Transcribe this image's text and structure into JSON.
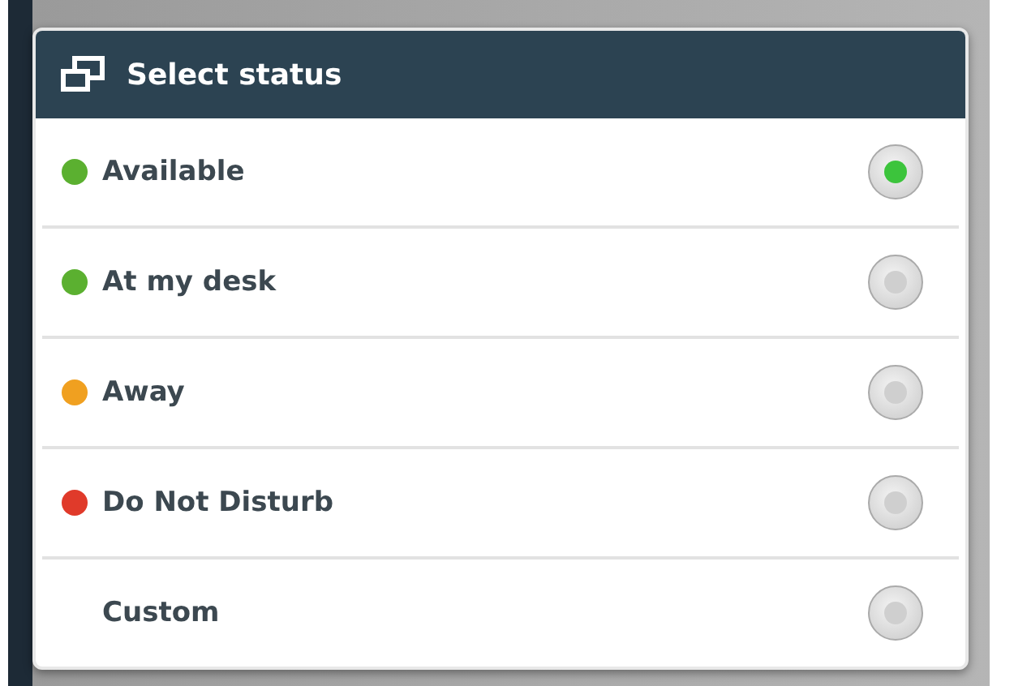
{
  "dialog": {
    "title": "Select status",
    "options": [
      {
        "label": "Available",
        "color": "#5bb030",
        "selected": true
      },
      {
        "label": "At my desk",
        "color": "#5bb030",
        "selected": false
      },
      {
        "label": "Away",
        "color": "#f0a020",
        "selected": false
      },
      {
        "label": "Do Not Disturb",
        "color": "#e03a2a",
        "selected": false
      },
      {
        "label": "Custom",
        "selected": false
      }
    ]
  }
}
